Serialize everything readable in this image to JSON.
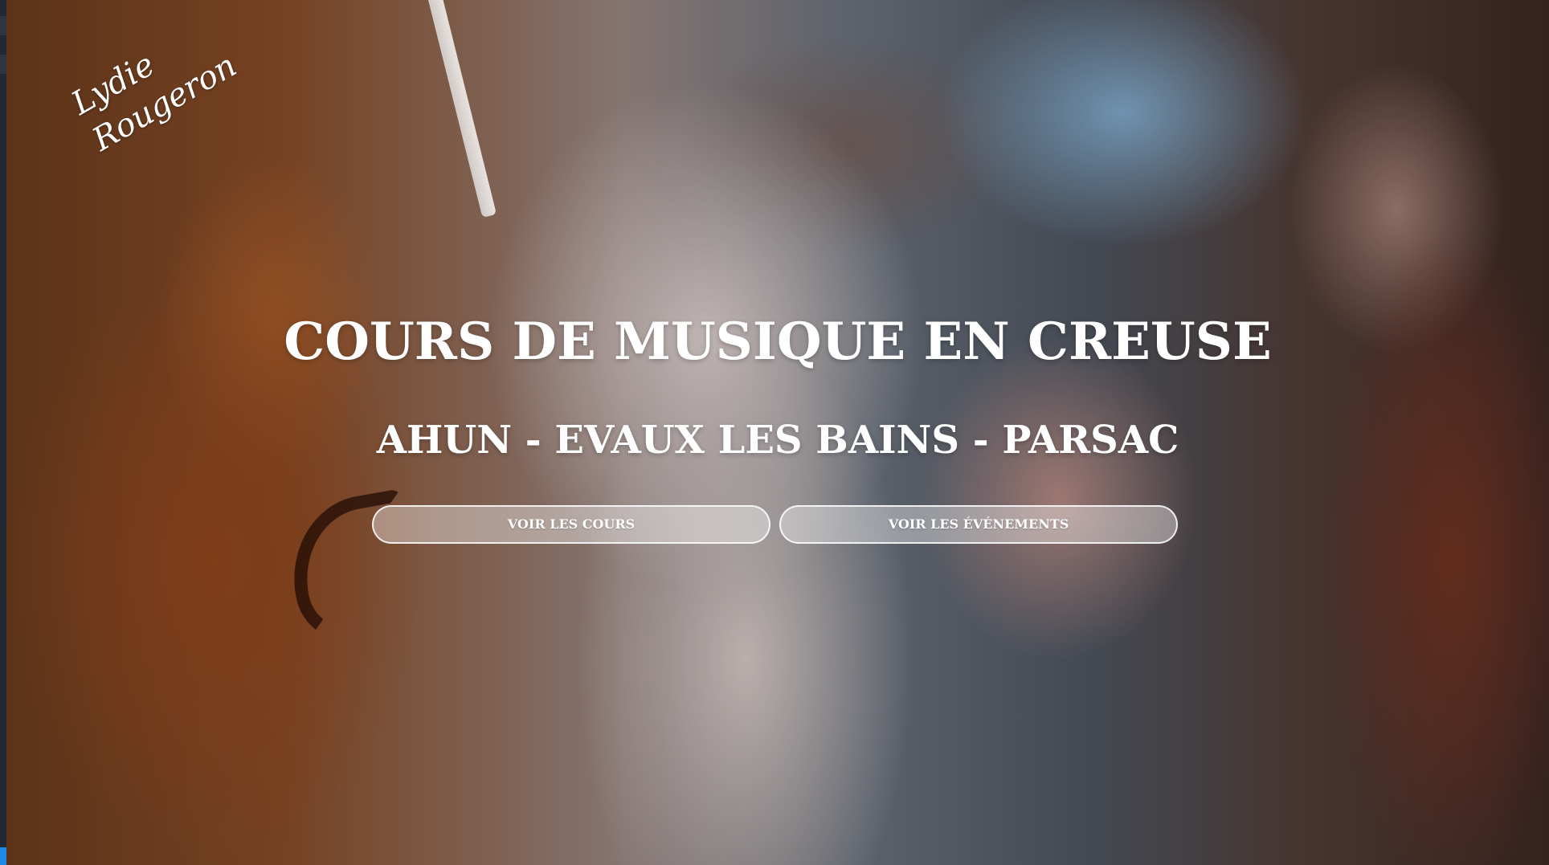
{
  "logo": {
    "line1": "Lydie",
    "line2": "Rougeron"
  },
  "hero": {
    "title": "COURS DE MUSIQUE EN CREUSE",
    "subtitle": "AHUN - EVAUX LES BAINS - PARSAC",
    "buttons": [
      {
        "label": "VOIR LES COURS"
      },
      {
        "label": "VOIR LES ÉVÉNEMENTS"
      }
    ]
  },
  "colors": {
    "text": "#ffffff",
    "button_border": "#ffffff",
    "side_indicator": "#1e88e5"
  }
}
